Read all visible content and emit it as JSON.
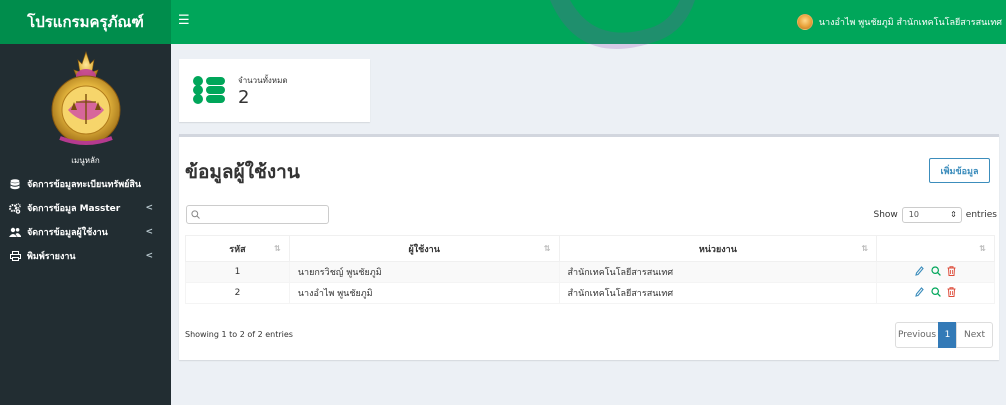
{
  "app": {
    "brand": "โปรแกรมครุภัณฑ์"
  },
  "header": {
    "menu_icon": "hamburger-icon",
    "user_name": "นางอำไพ พูนชัยภูมิ สำนักเทคโนโลยีสารสนเทศ"
  },
  "sidebar": {
    "menu_label": "เมนูหลัก",
    "items": [
      {
        "label": "จัดการข้อมูลทะเบียนทรัพย์สิน",
        "icon": "database-icon",
        "has_chevron": false
      },
      {
        "label": "จัดการข้อมูล Masster",
        "icon": "gears-icon",
        "has_chevron": true
      },
      {
        "label": "จัดการข้อมูลผู้ใช้งาน",
        "icon": "users-icon",
        "has_chevron": true
      },
      {
        "label": "พิมพ์รายงาน",
        "icon": "print-icon",
        "has_chevron": true
      }
    ]
  },
  "info_box": {
    "label": "จำนวนทั้งหมด",
    "count": "2",
    "icon": "list-icon"
  },
  "panel": {
    "title": "ข้อมูลผู้ใช้งาน",
    "add_button": "เพิ่มข้อมูล",
    "search_placeholder": "",
    "show_label": "Show",
    "show_value": "10",
    "entries_label": "entries",
    "columns": [
      "รหัส",
      "ผู้ใช้งาน",
      "หน่วยงาน",
      ""
    ],
    "rows": [
      {
        "id": "1",
        "name": "นายกรวิชญ์ พูนชัยภูมิ",
        "unit": "สำนักเทคโนโลยีสารสนเทศ"
      },
      {
        "id": "2",
        "name": "นางอำไพ พูนชัยภูมิ",
        "unit": "สำนักเทคโนโลยีสารสนเทศ"
      }
    ],
    "showing_text": "Showing 1 to 2 of 2 entries",
    "pagination": {
      "previous": "Previous",
      "current": "1",
      "next": "Next"
    }
  },
  "colors": {
    "header_green": "#00a65a",
    "brand_green": "#008d4c",
    "sidebar": "#222d32",
    "primary_blue": "#337ab7",
    "edit_blue": "#3c8dbc",
    "view_green": "#00a65a",
    "delete_red": "#dd4b39"
  }
}
